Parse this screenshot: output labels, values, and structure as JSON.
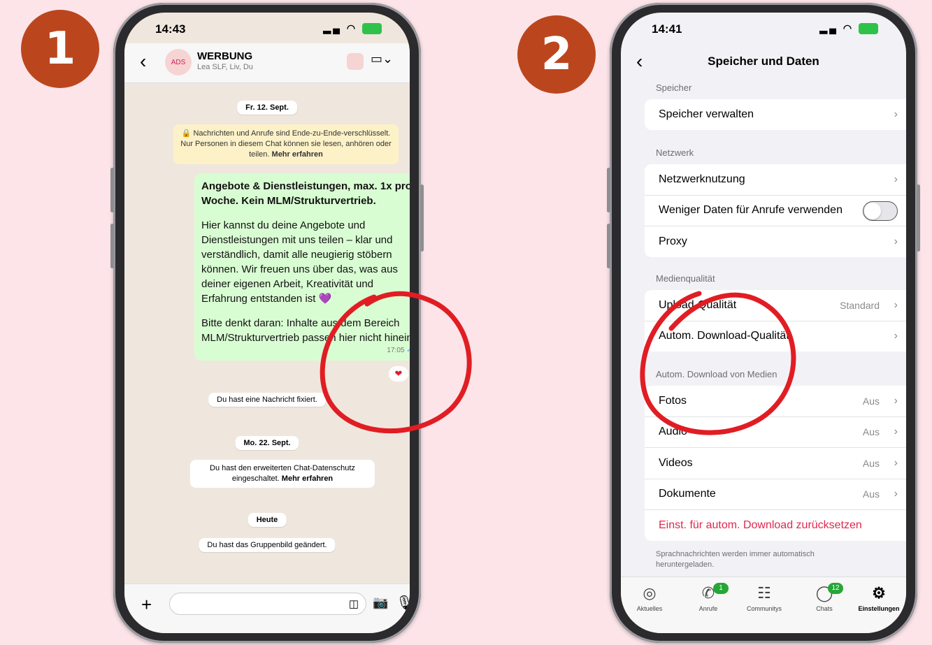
{
  "steps": {
    "one": "1",
    "two": "2"
  },
  "chat": {
    "time": "14:43",
    "group_name": "WERBUNG",
    "group_members": "Lea SLF, Liv, Du",
    "date1": "Fr. 12. Sept.",
    "encryption_text": "Nachrichten und Anrufe sind Ende-zu-Ende-verschlüsselt. Nur Personen in diesem Chat können sie lesen, anhören oder teilen.",
    "encryption_link": "Mehr erfahren",
    "message_heading": "Angebote & Dienstleistungen, max. 1x pro Woche. Kein MLM/Strukturvertrieb.",
    "message_body": "Hier kannst du deine Angebote und Dienstleistungen mit uns teilen – klar und verständlich, damit alle neugierig stöbern können. Wir freuen uns über das, was aus deiner eigenen Arbeit, Kreativität und Erfahrung entstanden ist 💜",
    "message_note": "Bitte denkt daran: Inhalte aus dem Bereich MLM/Strukturvertrieb passen hier nicht hinein.",
    "message_time": "17:05",
    "pinned_msg": "Du hast eine Nachricht fixiert.",
    "date2": "Mo. 22. Sept.",
    "privacy_msg": "Du hast den erweiterten Chat-Datenschutz eingeschaltet.",
    "privacy_link": "Mehr erfahren",
    "date3": "Heute",
    "groupimg_msg": "Du hast das Gruppenbild geändert."
  },
  "settings": {
    "time": "14:41",
    "title": "Speicher und Daten",
    "sec_storage": "Speicher",
    "manage_storage": "Speicher verwalten",
    "sec_network": "Netzwerk",
    "network_usage": "Netzwerknutzung",
    "less_data": "Weniger Daten für Anrufe verwenden",
    "proxy": "Proxy",
    "sec_media": "Medienqualität",
    "upload_quality": "Upload-Qualität",
    "upload_value": "Standard",
    "auto_download_quality": "Autom. Download-Qualität",
    "sec_auto": "Autom. Download von Medien",
    "photos": "Fotos",
    "photos_value": "Aus",
    "audio": "Audio",
    "audio_value": "Aus",
    "videos": "Videos",
    "videos_value": "Aus",
    "documents": "Dokumente",
    "documents_value": "Aus",
    "reset": "Einst. für autom. Download zurücksetzen",
    "footnote": "Sprachnachrichten werden immer automatisch heruntergeladen.",
    "tabs": {
      "updates": "Aktuelles",
      "calls": "Anrufe",
      "calls_badge": "1",
      "communities": "Communitys",
      "chats": "Chats",
      "chats_badge": "12",
      "settings": "Einstellungen"
    }
  },
  "colors": {
    "background": "#fce4e8",
    "step_circle": "#bb461e",
    "annotation": "#e11d24",
    "accent_green": "#26a637",
    "danger": "#e0284f"
  }
}
